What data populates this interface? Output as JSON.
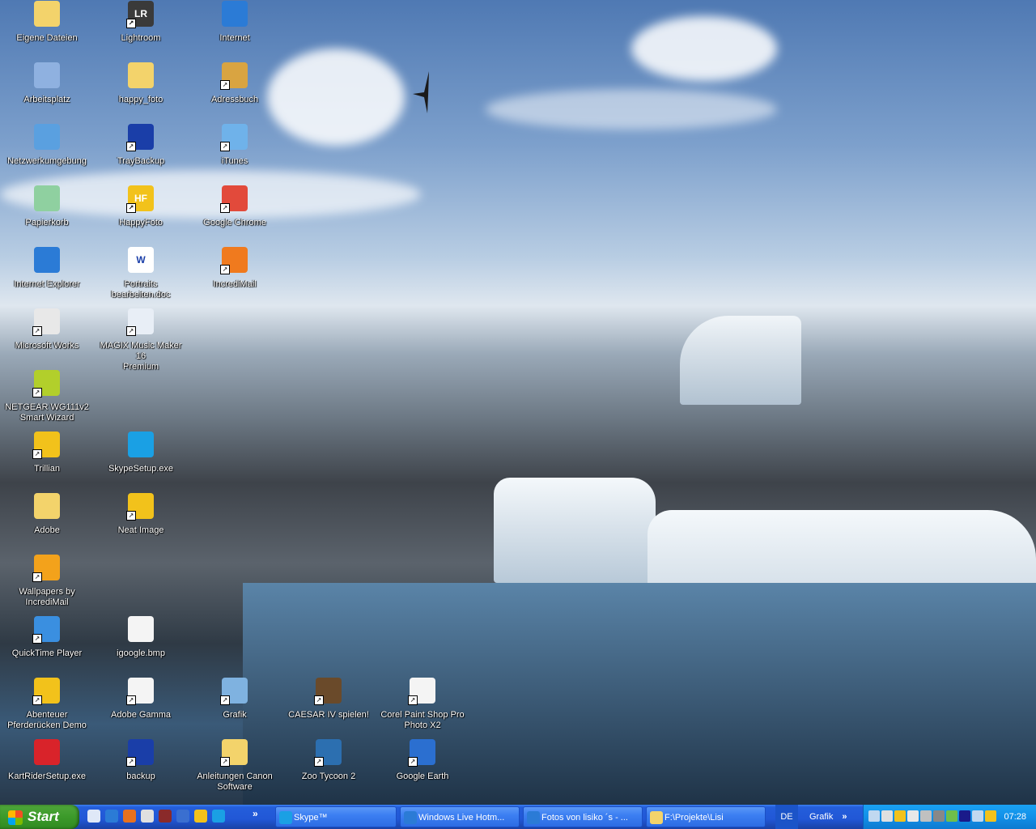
{
  "desktop": {
    "icons": [
      {
        "label": "Eigene Dateien",
        "icon": "documents-folder-icon",
        "color": "#f3d36b",
        "shortcut": false
      },
      {
        "label": "Lightroom",
        "icon": "lightroom-icon",
        "color": "#3a3a3a",
        "shortcut": true,
        "glyph_text": "LR"
      },
      {
        "label": "Internet",
        "icon": "internet-explorer-icon",
        "color": "#2b7bd6",
        "shortcut": false
      },
      {
        "label": "Arbeitsplatz",
        "icon": "my-computer-icon",
        "color": "#8fb1e0",
        "shortcut": false
      },
      {
        "label": "happy_foto",
        "icon": "folder-icon",
        "color": "#f3d36b",
        "shortcut": false
      },
      {
        "label": "Adressbuch",
        "icon": "address-book-icon",
        "color": "#d9a441",
        "shortcut": true
      },
      {
        "label": "Netzwerkumgebung",
        "icon": "network-icon",
        "color": "#5aa0e0",
        "shortcut": false
      },
      {
        "label": "TrayBackup",
        "icon": "traybackup-icon",
        "color": "#1a3ea8",
        "shortcut": true
      },
      {
        "label": "iTunes",
        "icon": "itunes-icon",
        "color": "#6fb2ea",
        "shortcut": true
      },
      {
        "label": "Papierkorb",
        "icon": "recycle-bin-icon",
        "color": "#8fd0a0",
        "shortcut": false
      },
      {
        "label": "HappyFoto",
        "icon": "happyfoto-icon",
        "color": "#f2c21b",
        "shortcut": true,
        "glyph_text": "HF"
      },
      {
        "label": "Google Chrome",
        "icon": "chrome-icon",
        "color": "#e24a3b",
        "shortcut": true
      },
      {
        "label": "Internet Explorer",
        "icon": "internet-explorer-icon",
        "color": "#2b7bd6",
        "shortcut": false
      },
      {
        "label": "Portraits\nbearbeiten.doc",
        "icon": "word-document-icon",
        "color": "#ffffff",
        "shortcut": false,
        "glyph_text": "W"
      },
      {
        "label": "IncrediMail",
        "icon": "incredimail-icon",
        "color": "#f07a1e",
        "shortcut": true
      },
      {
        "label": "Microsoft Works",
        "icon": "microsoft-works-icon",
        "color": "#e8e8e8",
        "shortcut": true
      },
      {
        "label": "MAGIX Music Maker 16\nPremium",
        "icon": "magix-icon",
        "color": "#e8eef6",
        "shortcut": true
      },
      {
        "label": "NETGEAR WG111v2\nSmart Wizard",
        "icon": "netgear-icon",
        "color": "#b2cf2b",
        "shortcut": true
      },
      {
        "label": "Trillian",
        "icon": "trillian-icon",
        "color": "#f2c21b",
        "shortcut": true
      },
      {
        "label": "SkypeSetup.exe",
        "icon": "skype-setup-icon",
        "color": "#1aa0e4",
        "shortcut": false
      },
      {
        "label": "Adobe",
        "icon": "folder-icon",
        "color": "#f3d36b",
        "shortcut": false
      },
      {
        "label": "Neat Image",
        "icon": "neat-image-icon",
        "color": "#f2c21b",
        "shortcut": true
      },
      {
        "label": "Wallpapers by\nIncrediMail",
        "icon": "wallpapers-icon",
        "color": "#f3a21b",
        "shortcut": true
      },
      {
        "label": "QuickTime Player",
        "icon": "quicktime-icon",
        "color": "#3a8fe0",
        "shortcut": true
      },
      {
        "label": "igoogle.bmp",
        "icon": "bitmap-image-icon",
        "color": "#f4f4f4",
        "shortcut": false
      },
      {
        "label": "Abenteuer\nPferderücken Demo",
        "icon": "game-icon",
        "color": "#f2c21b",
        "shortcut": true
      },
      {
        "label": "Adobe Gamma",
        "icon": "adobe-gamma-icon",
        "color": "#f4f4f4",
        "shortcut": true
      },
      {
        "label": "Grafik",
        "icon": "grafik-icon",
        "color": "#7fb2e0",
        "shortcut": true
      },
      {
        "label": "CAESAR IV spielen!",
        "icon": "caesar-icon",
        "color": "#6a4a2a",
        "shortcut": true
      },
      {
        "label": "Corel Paint Shop Pro\nPhoto X2",
        "icon": "corel-icon",
        "color": "#f4f4f4",
        "shortcut": true
      },
      {
        "label": "KartRiderSetup.exe",
        "icon": "kartrider-icon",
        "color": "#d9232a",
        "shortcut": false
      },
      {
        "label": "backup",
        "icon": "traybackup-icon",
        "color": "#1a3ea8",
        "shortcut": true
      },
      {
        "label": "Anleitungen Canon\nSoftware",
        "icon": "folder-icon",
        "color": "#f3d36b",
        "shortcut": true
      },
      {
        "label": "Zoo Tycoon 2",
        "icon": "zoo-tycoon-icon",
        "color": "#2c6fb0",
        "shortcut": true
      },
      {
        "label": "Google Earth",
        "icon": "google-earth-icon",
        "color": "#2b6fd0",
        "shortcut": true
      }
    ]
  },
  "taskbar": {
    "start_label": "Start",
    "quicklaunch": [
      {
        "icon": "show-desktop-icon",
        "color": "#dfe8f7"
      },
      {
        "icon": "internet-explorer-icon",
        "color": "#2b7bd6"
      },
      {
        "icon": "firefox-icon",
        "color": "#e8711e"
      },
      {
        "icon": "media-player-icon",
        "color": "#e0e0e0"
      },
      {
        "icon": "app-icon",
        "color": "#8a2a2a"
      },
      {
        "icon": "thunderbird-icon",
        "color": "#3a6fd0"
      },
      {
        "icon": "incredimail-icon",
        "color": "#f2c21b"
      },
      {
        "icon": "skype-icon",
        "color": "#1aa0e4"
      }
    ],
    "tasks": [
      {
        "label": "Skype™",
        "icon": "skype-icon",
        "color": "#1aa0e4"
      },
      {
        "label": "Windows Live Hotm...",
        "icon": "internet-explorer-icon",
        "color": "#2b7bd6"
      },
      {
        "label": "Fotos von lisiko ´s - ...",
        "icon": "internet-explorer-icon",
        "color": "#2b7bd6"
      },
      {
        "label": "F:\\Projekte\\Lisi",
        "icon": "folder-icon",
        "color": "#f3d36b"
      }
    ],
    "language": "DE",
    "toolbar_label": "Grafik",
    "tray_icons": [
      {
        "icon": "network-tray-icon",
        "color": "#c0d8f0"
      },
      {
        "icon": "tray-close-icon",
        "color": "#e0e0e0"
      },
      {
        "icon": "security-shield-icon",
        "color": "#f2c21b"
      },
      {
        "icon": "volume-icon",
        "color": "#e8e8e8"
      },
      {
        "icon": "network-connection-icon",
        "color": "#c0c0c0"
      },
      {
        "icon": "status-icon",
        "color": "#888888"
      },
      {
        "icon": "sync-icon",
        "color": "#6fbf4a"
      },
      {
        "icon": "display-icon",
        "color": "#1a1a8a"
      },
      {
        "icon": "monitor-icon",
        "color": "#c0d8f0"
      },
      {
        "icon": "trillian-tray-icon",
        "color": "#f2c21b"
      }
    ],
    "clock": "07:28"
  }
}
